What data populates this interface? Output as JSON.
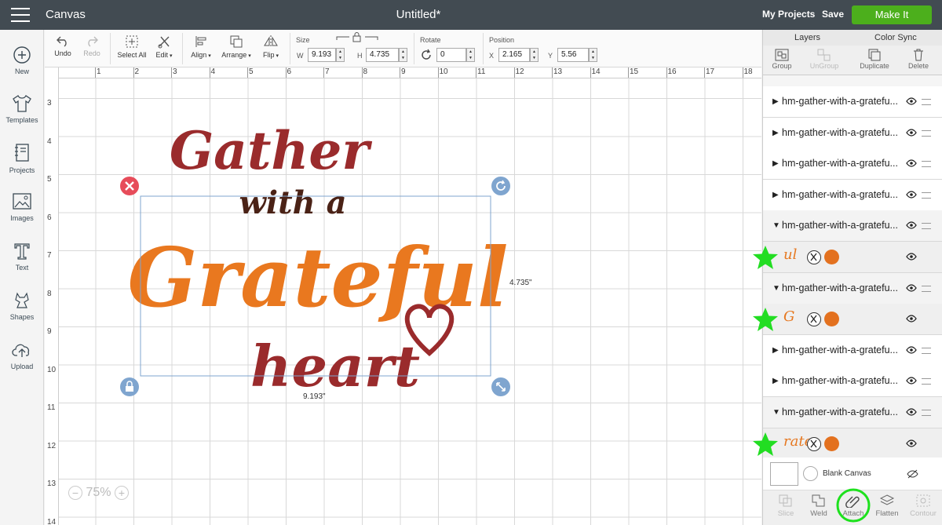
{
  "topbar": {
    "app_title": "Canvas",
    "doc_title": "Untitled*",
    "my_projects": "My Projects",
    "save": "Save",
    "make_it": "Make It",
    "make_it_color": "#4caf1c"
  },
  "leftbar": {
    "items": [
      {
        "label": "New",
        "icon": "plus-circle-icon"
      },
      {
        "label": "Templates",
        "icon": "tshirt-icon"
      },
      {
        "label": "Projects",
        "icon": "notebook-icon"
      },
      {
        "label": "Images",
        "icon": "image-icon"
      },
      {
        "label": "Text",
        "icon": "text-t-icon"
      },
      {
        "label": "Shapes",
        "icon": "shapes-icon"
      },
      {
        "label": "Upload",
        "icon": "cloud-upload-icon"
      }
    ]
  },
  "toolbar": {
    "undo": "Undo",
    "redo": "Redo",
    "select_all": "Select All",
    "edit": "Edit",
    "align": "Align",
    "arrange": "Arrange",
    "flip": "Flip",
    "size_label": "Size",
    "w_label": "W",
    "w_value": "9.193",
    "h_label": "H",
    "h_value": "4.735",
    "rotate_label": "Rotate",
    "rotate_value": "0",
    "position_label": "Position",
    "x_label": "X",
    "x_value": "2.165",
    "y_label": "Y",
    "y_value": "5.56"
  },
  "rulers": {
    "top": [
      "1",
      "2",
      "3",
      "4",
      "5",
      "6",
      "7",
      "8",
      "9",
      "10",
      "11",
      "12",
      "13",
      "14",
      "15",
      "16",
      "17",
      "18"
    ],
    "left": [
      "3",
      "4",
      "5",
      "6",
      "7",
      "8",
      "9",
      "10",
      "11",
      "12",
      "13",
      "14"
    ]
  },
  "canvas": {
    "height_readout": "4.735\"",
    "width_readout": "9.193\"",
    "design_lines": [
      "Gather",
      "with a",
      "Grateful",
      "heart"
    ],
    "colors": {
      "dark_red": "#9a2b2c",
      "brown": "#4a2216",
      "orange": "#e9781f",
      "selection": "#7fa5cf",
      "delete": "#e74c5a"
    },
    "zoom": "75%",
    "zoom_minus": "−",
    "zoom_plus": "+"
  },
  "layers_panel": {
    "tab_layers": "Layers",
    "tab_color_sync": "Color Sync",
    "tools": [
      {
        "label": "Group",
        "enabled": true
      },
      {
        "label": "UnGroup",
        "enabled": false
      },
      {
        "label": "Duplicate",
        "enabled": true
      },
      {
        "label": "Delete",
        "enabled": true
      }
    ],
    "rows": [
      {
        "kind": "group",
        "name": "hm-gather-with-a-gratefu...",
        "expanded": false
      },
      {
        "kind": "group",
        "name": "hm-gather-with-a-gratefu...",
        "expanded": false
      },
      {
        "kind": "group",
        "name": "hm-gather-with-a-gratefu...",
        "expanded": false
      },
      {
        "kind": "group",
        "name": "hm-gather-with-a-gratefu...",
        "expanded": false
      },
      {
        "kind": "group",
        "name": "hm-gather-with-a-gratefu...",
        "expanded": true
      },
      {
        "kind": "sub",
        "thumb": "ul",
        "color": "#e3711f"
      },
      {
        "kind": "group",
        "name": "hm-gather-with-a-gratefu...",
        "expanded": true
      },
      {
        "kind": "sub",
        "thumb": "G",
        "color": "#e3711f"
      },
      {
        "kind": "group",
        "name": "hm-gather-with-a-gratefu...",
        "expanded": false
      },
      {
        "kind": "group",
        "name": "hm-gather-with-a-gratefu...",
        "expanded": false
      },
      {
        "kind": "group",
        "name": "hm-gather-with-a-gratefu...",
        "expanded": true
      },
      {
        "kind": "sub",
        "thumb": "rate",
        "color": "#e3711f"
      }
    ],
    "blank_canvas": "Blank Canvas",
    "bottom": [
      {
        "label": "Slice",
        "enabled": false
      },
      {
        "label": "Weld",
        "enabled": true
      },
      {
        "label": "Attach",
        "enabled": true
      },
      {
        "label": "Flatten",
        "enabled": true
      },
      {
        "label": "Contour",
        "enabled": false
      }
    ]
  }
}
